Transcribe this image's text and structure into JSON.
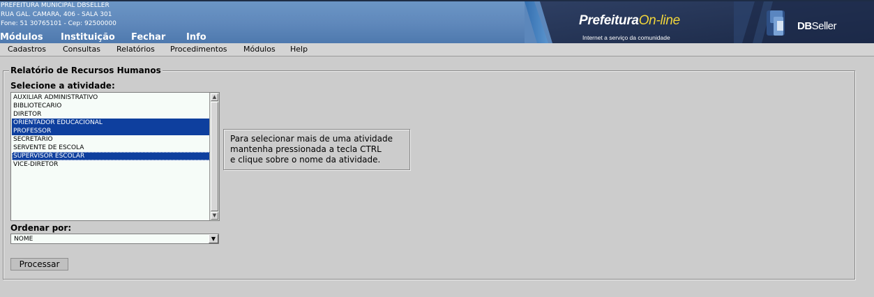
{
  "header": {
    "org_name": "PREFEITURA MUNICIPAL DBSELLER",
    "address": "RUA GAL. CAMARA, 406 - SALA 301",
    "contact": "Fone: 51 30765101  -  Cep: 92500000",
    "main_menu": [
      "Módulos",
      "Instituição",
      "Fechar",
      "Info"
    ],
    "banner": {
      "brand_primary": "Prefeitura",
      "brand_secondary": "On-line",
      "tagline": "Internet a serviço da comunidade",
      "company_bold": "DB",
      "company_rest": "Seller"
    },
    "colors": {
      "header_blue": "#5f88bb",
      "brand_accent": "#f1d53a",
      "banner_dark": "#1e2c4d"
    }
  },
  "submenu": [
    "Cadastros",
    "Consultas",
    "Relatórios",
    "Procedimentos",
    "Módulos",
    "Help"
  ],
  "form": {
    "legend": "Relatório de Recursos Humanos",
    "atividade_label": "Selecione a atividade:",
    "atividades": [
      {
        "label": "AUXILIAR ADMINISTRATIVO",
        "selected": false
      },
      {
        "label": "BIBLIOTECARIO",
        "selected": false
      },
      {
        "label": "DIRETOR",
        "selected": false
      },
      {
        "label": "ORIENTADOR EDUCACIONAL",
        "selected": true
      },
      {
        "label": "PROFESSOR",
        "selected": true
      },
      {
        "label": "SECRETARIO",
        "selected": false
      },
      {
        "label": "SERVENTE DE ESCOLA",
        "selected": false
      },
      {
        "label": "SUPERVISOR ESCOLAR",
        "selected": true
      },
      {
        "label": "VICE-DIRETOR",
        "selected": false
      }
    ],
    "info_lines": [
      "Para selecionar mais de uma atividade",
      "mantenha pressionada a tecla CTRL",
      "e clique sobre o nome da atividade."
    ],
    "ordenar_label": "Ordenar por:",
    "ordenar_value": "NOME",
    "submit_label": "Processar",
    "colors": {
      "selection": "#0e3f9e",
      "list_bg": "#f6fcf8"
    }
  }
}
